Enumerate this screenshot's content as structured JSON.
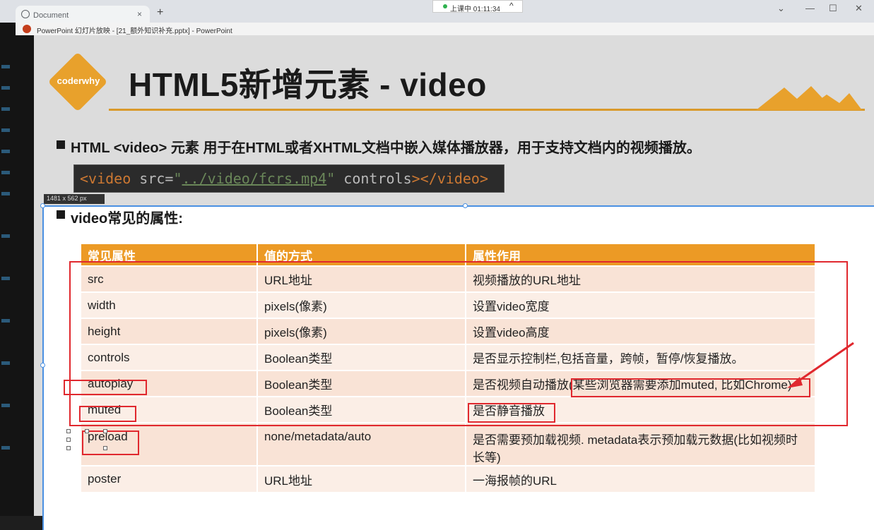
{
  "browser": {
    "tab_title": "Document",
    "tab_close": "×",
    "new_tab": "+",
    "timer_text": "上课中 01:11:34",
    "timer_chevron": "^",
    "win_min": "—",
    "win_max": "☐",
    "win_close": "✕",
    "win_collapse": "⌄"
  },
  "ppt": {
    "window_title": "PowerPoint 幻灯片放映 - [21_额外知识补充.pptx] - PowerPoint"
  },
  "slide": {
    "logo_text": "coderwhy",
    "title": "HTML5新增元素 - video",
    "description": "HTML <video> 元素 用于在HTML或者XHTML文档中嵌入媒体播放器，用于支持文档内的视频播放。",
    "code": {
      "open_tag": "<video",
      "attr1": " src=",
      "str_quote_open": "\"",
      "str_path": "../video/fcrs.mp4",
      "str_quote_close": "\"",
      "attr2": " controls",
      "close": "></video>"
    },
    "selection_size": "1481 x 562  px",
    "subheading": "video常见的属性:",
    "table": {
      "headers": [
        "常见属性",
        "值的方式",
        "属性作用"
      ],
      "rows": [
        [
          "src",
          "URL地址",
          "视频播放的URL地址"
        ],
        [
          "width",
          "pixels(像素)",
          "设置video宽度"
        ],
        [
          "height",
          "pixels(像素)",
          "设置video高度"
        ],
        [
          "controls",
          "Boolean类型",
          "是否显示控制栏,包括音量，跨帧，暂停/恢复播放。"
        ],
        [
          "autoplay",
          "Boolean类型",
          "是否视频自动播放(某些浏览器需要添加muted, 比如Chrome)"
        ],
        [
          "muted",
          "Boolean类型",
          "是否静音播放"
        ],
        [
          "preload",
          "none/metadata/auto",
          "是否需要预加载视频. metadata表示预加载元数据(比如视频时长等)"
        ],
        [
          "poster",
          "URL地址",
          "一海报帧的URL"
        ]
      ]
    }
  },
  "colors": {
    "accent_orange": "#ec9a25",
    "annotation_red": "#e0282e",
    "selection_blue": "#4a90e2"
  }
}
